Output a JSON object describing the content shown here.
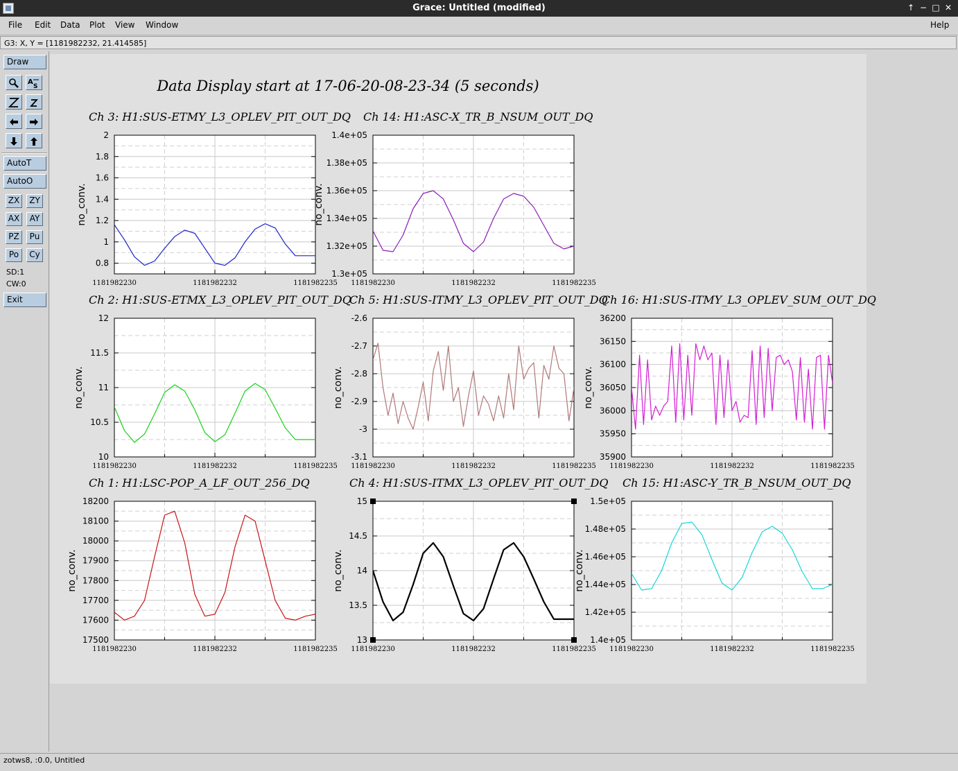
{
  "window": {
    "title": "Grace: Untitled (modified)",
    "controls": [
      "↑",
      "−",
      "□",
      "✕"
    ]
  },
  "menubar": {
    "items": [
      "File",
      "Edit",
      "Data",
      "Plot",
      "View",
      "Window"
    ],
    "help": "Help"
  },
  "locator": "G3: X, Y = [1181982232, 21.414585]",
  "toolbar": {
    "draw": "Draw",
    "autot": "AutoT",
    "autoo": "AutoO",
    "grid_buttons": [
      "ZX",
      "ZY",
      "AX",
      "AY",
      "PZ",
      "Pu",
      "Po",
      "Cy"
    ],
    "sd": "SD:1",
    "cw": "CW:0",
    "exit": "Exit",
    "icons": [
      "zoom-icon",
      "text-icon",
      "autoscale-z-icon",
      "z-icon",
      "arrow-left-icon",
      "arrow-right-icon",
      "arrow-down-icon",
      "arrow-up-icon"
    ]
  },
  "status": "zotws8, :0.0, Untitled",
  "page_title": "Data Display start at 17-06-20-08-23-34 (5 seconds)",
  "chart_data": [
    {
      "type": "line",
      "title": "Ch 3: H1:SUS-ETMY_L3_OPLEV_PIT_OUT_DQ",
      "ylabel": "no_conv.",
      "color": "#1a22c8",
      "ylim": [
        0.7,
        2.0
      ],
      "yticks": [
        0.8,
        1.0,
        1.2,
        1.4,
        1.6,
        1.8,
        2.0
      ],
      "ytick_labels": [
        "0.8",
        "1",
        "1.2",
        "1.4",
        "1.6",
        "1.8",
        "2"
      ],
      "xtick_labels": [
        "1181982230",
        "1181982232",
        "1181982235"
      ],
      "x": [
        0,
        0.5,
        1,
        1.5,
        2,
        2.5,
        3,
        3.5,
        4,
        4.5,
        5,
        5.5,
        6,
        6.5,
        7,
        7.5,
        8,
        8.5,
        9,
        9.5,
        10
      ],
      "y": [
        1.16,
        1.02,
        0.86,
        0.78,
        0.82,
        0.94,
        1.05,
        1.11,
        1.08,
        0.94,
        0.8,
        0.78,
        0.85,
        1.0,
        1.12,
        1.17,
        1.13,
        0.98,
        0.87,
        0.87,
        0.87
      ]
    },
    {
      "type": "line",
      "title": "Ch 14: H1:ASC-X_TR_B_NSUM_OUT_DQ",
      "ylabel": "no_conv.",
      "color": "#8a1cb8",
      "ylim": [
        130000,
        140000
      ],
      "yticks": [
        130000,
        132000,
        134000,
        136000,
        138000,
        140000
      ],
      "ytick_labels": [
        "1.3e+05",
        "1.32e+05",
        "1.34e+05",
        "1.36e+05",
        "1.38e+05",
        "1.4e+05"
      ],
      "xtick_labels": [
        "1181982230",
        "1181982232",
        "1181982235"
      ],
      "x": [
        0,
        0.5,
        1,
        1.5,
        2,
        2.5,
        3,
        3.5,
        4,
        4.5,
        5,
        5.5,
        6,
        6.5,
        7,
        7.5,
        8,
        8.5,
        9,
        9.5,
        10
      ],
      "y": [
        133100,
        131700,
        131600,
        132800,
        134700,
        135800,
        136000,
        135400,
        133900,
        132200,
        131600,
        132300,
        134000,
        135400,
        135800,
        135600,
        134800,
        133500,
        132200,
        131800,
        132000
      ]
    },
    {
      "type": "line",
      "title": "Ch 2: H1:SUS-ETMX_L3_OPLEV_PIT_OUT_DQ",
      "ylabel": "no_conv.",
      "color": "#18d018",
      "ylim": [
        10,
        12
      ],
      "yticks": [
        10,
        10.5,
        11,
        11.5,
        12
      ],
      "ytick_labels": [
        "10",
        "10.5",
        "11",
        "11.5",
        "12"
      ],
      "xtick_labels": [
        "1181982230",
        "1181982232",
        "1181982235"
      ],
      "x": [
        0,
        0.5,
        1,
        1.5,
        2,
        2.5,
        3,
        3.5,
        4,
        4.5,
        5,
        5.5,
        6,
        6.5,
        7,
        7.5,
        8,
        8.5,
        9,
        9.5,
        10
      ],
      "y": [
        10.72,
        10.38,
        10.21,
        10.33,
        10.62,
        10.93,
        11.04,
        10.95,
        10.68,
        10.35,
        10.22,
        10.32,
        10.63,
        10.95,
        11.06,
        10.97,
        10.7,
        10.42,
        10.25,
        10.25,
        10.25
      ]
    },
    {
      "type": "line",
      "title": "Ch 5: H1:SUS-ITMY_L3_OPLEV_PIT_OUT_DQ",
      "ylabel": "no_conv.",
      "color": "#b07878",
      "ylim": [
        -3.1,
        -2.6
      ],
      "yticks": [
        -3.1,
        -3.0,
        -2.9,
        -2.8,
        -2.7,
        -2.6
      ],
      "ytick_labels": [
        "-3.1",
        "-3",
        "-2.9",
        "-2.8",
        "-2.7",
        "-2.6"
      ],
      "xtick_labels": [
        "1181982230",
        "1181982232",
        "1181982235"
      ],
      "x": [
        0,
        0.25,
        0.5,
        0.75,
        1,
        1.25,
        1.5,
        1.75,
        2,
        2.25,
        2.5,
        2.75,
        3,
        3.25,
        3.5,
        3.75,
        4,
        4.25,
        4.5,
        4.75,
        5,
        5.25,
        5.5,
        5.75,
        6,
        6.25,
        6.5,
        6.75,
        7,
        7.25,
        7.5,
        7.75,
        8,
        8.25,
        8.5,
        8.75,
        9,
        9.25,
        9.5,
        9.75,
        10
      ],
      "y": [
        -2.75,
        -2.69,
        -2.85,
        -2.95,
        -2.87,
        -2.98,
        -2.9,
        -2.96,
        -3.0,
        -2.92,
        -2.83,
        -2.97,
        -2.79,
        -2.72,
        -2.86,
        -2.7,
        -2.9,
        -2.85,
        -2.99,
        -2.88,
        -2.79,
        -2.95,
        -2.88,
        -2.91,
        -2.97,
        -2.88,
        -2.96,
        -2.8,
        -2.93,
        -2.7,
        -2.82,
        -2.78,
        -2.76,
        -2.96,
        -2.77,
        -2.82,
        -2.7,
        -2.78,
        -2.8,
        -2.97,
        -2.85
      ]
    },
    {
      "type": "line",
      "title": "Ch 16: H1:SUS-ITMY_L3_OPLEV_SUM_OUT_DQ",
      "ylabel": "no_conv.",
      "color": "#d41cd4",
      "ylim": [
        35900,
        36200
      ],
      "yticks": [
        35900,
        35950,
        36000,
        36050,
        36100,
        36150,
        36200
      ],
      "ytick_labels": [
        "35900",
        "35950",
        "36000",
        "36050",
        "36100",
        "36150",
        "36200"
      ],
      "xtick_labels": [
        "1181982230",
        "1181982232",
        "1181982235"
      ],
      "x": [
        0,
        0.2,
        0.4,
        0.6,
        0.8,
        1,
        1.2,
        1.4,
        1.6,
        1.8,
        2,
        2.2,
        2.4,
        2.6,
        2.8,
        3,
        3.2,
        3.4,
        3.6,
        3.8,
        4,
        4.2,
        4.4,
        4.6,
        4.8,
        5,
        5.2,
        5.4,
        5.6,
        5.8,
        6,
        6.2,
        6.4,
        6.6,
        6.8,
        7,
        7.2,
        7.4,
        7.6,
        7.8,
        8,
        8.2,
        8.4,
        8.6,
        8.8,
        9,
        9.2,
        9.4,
        9.6,
        9.8,
        10
      ],
      "y": [
        36050,
        35960,
        36120,
        35970,
        36110,
        35980,
        36010,
        35990,
        36010,
        36020,
        36140,
        35975,
        36145,
        35980,
        36120,
        35990,
        36145,
        36110,
        36140,
        36110,
        36125,
        35970,
        36120,
        35985,
        36110,
        36000,
        36020,
        35975,
        35990,
        35985,
        36130,
        35970,
        36140,
        35985,
        36135,
        36000,
        36115,
        36120,
        36100,
        36110,
        36085,
        35980,
        36115,
        35975,
        36090,
        35960,
        36115,
        36120,
        35960,
        36120,
        36060
      ]
    },
    {
      "type": "line",
      "title": "Ch 1: H1:LSC-POP_A_LF_OUT_256_DQ",
      "ylabel": "no_conv.",
      "color": "#c81414",
      "ylim": [
        17500,
        18200
      ],
      "yticks": [
        17500,
        17600,
        17700,
        17800,
        17900,
        18000,
        18100,
        18200
      ],
      "ytick_labels": [
        "17500",
        "17600",
        "17700",
        "17800",
        "17900",
        "18000",
        "18100",
        "18200"
      ],
      "xtick_labels": [
        "1181982230",
        "1181982232",
        "1181982235"
      ],
      "x": [
        0,
        0.5,
        1,
        1.5,
        2,
        2.5,
        3,
        3.5,
        4,
        4.5,
        5,
        5.5,
        6,
        6.5,
        7,
        7.5,
        8,
        8.5,
        9,
        9.5,
        10
      ],
      "y": [
        17640,
        17600,
        17620,
        17700,
        17920,
        18130,
        18150,
        17990,
        17730,
        17620,
        17630,
        17740,
        17970,
        18130,
        18100,
        17900,
        17700,
        17610,
        17600,
        17620,
        17630
      ]
    },
    {
      "type": "line",
      "title": "Ch 4: H1:SUS-ITMX_L3_OPLEV_PIT_OUT_DQ",
      "ylabel": "no_conv.",
      "color": "#000000",
      "ylim": [
        13,
        15
      ],
      "yticks": [
        13,
        13.5,
        14,
        14.5,
        15
      ],
      "ytick_labels": [
        "13",
        "13.5",
        "14",
        "14.5",
        "15"
      ],
      "xtick_labels": [
        "1181982230",
        "1181982232",
        "1181982235"
      ],
      "x": [
        0,
        0.5,
        1,
        1.5,
        2,
        2.5,
        3,
        3.5,
        4,
        4.5,
        5,
        5.5,
        6,
        6.5,
        7,
        7.5,
        8,
        8.5,
        9,
        9.5,
        10
      ],
      "y": [
        14.0,
        13.55,
        13.28,
        13.4,
        13.8,
        14.25,
        14.4,
        14.2,
        13.78,
        13.38,
        13.28,
        13.45,
        13.88,
        14.3,
        14.4,
        14.2,
        13.88,
        13.55,
        13.3,
        13.3,
        13.3
      ]
    },
    {
      "type": "line",
      "title": "Ch 15: H1:ASC-Y_TR_B_NSUM_OUT_DQ",
      "ylabel": "no_conv.",
      "color": "#14d8d8",
      "ylim": [
        140000,
        150000
      ],
      "yticks": [
        140000,
        142000,
        144000,
        146000,
        148000,
        150000
      ],
      "ytick_labels": [
        "1.4e+05",
        "1.42e+05",
        "1.44e+05",
        "1.46e+05",
        "1.48e+05",
        "1.5e+05"
      ],
      "xtick_labels": [
        "1181982230",
        "1181982232",
        "1181982235"
      ],
      "x": [
        0,
        0.5,
        1,
        1.5,
        2,
        2.5,
        3,
        3.5,
        4,
        4.5,
        5,
        5.5,
        6,
        6.5,
        7,
        7.5,
        8,
        8.5,
        9,
        9.5,
        10
      ],
      "y": [
        144800,
        143600,
        143700,
        145000,
        147000,
        148400,
        148500,
        147600,
        145800,
        144100,
        143600,
        144500,
        146300,
        147800,
        148200,
        147700,
        146500,
        144900,
        143700,
        143700,
        144000
      ]
    }
  ]
}
